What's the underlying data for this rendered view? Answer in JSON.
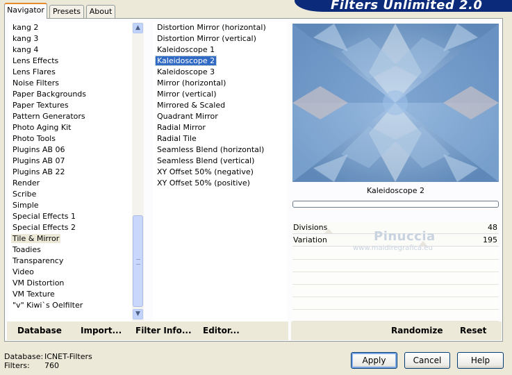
{
  "header": {
    "banner_text": "Filters Unlimited 2.0"
  },
  "tabs": [
    {
      "label": "Navigator",
      "active": true
    },
    {
      "label": "Presets",
      "active": false
    },
    {
      "label": "About",
      "active": false
    }
  ],
  "categories": {
    "items": [
      "kang 2",
      "kang 3",
      "kang 4",
      "Lens Effects",
      "Lens Flares",
      "Noise Filters",
      "Paper Backgrounds",
      "Paper Textures",
      "Pattern Generators",
      "Photo Aging Kit",
      "Photo Tools",
      "Plugins AB 06",
      "Plugins AB 07",
      "Plugins AB 22",
      "Render",
      "Scribe",
      "Simple",
      "Special Effects 1",
      "Special Effects 2",
      "Tile & Mirror",
      "Toadies",
      "Transparency",
      "Video",
      "VM Distortion",
      "VM Texture",
      "\"v\" Kiwi`s Oelfilter"
    ],
    "selected": "Tile & Mirror"
  },
  "filters": {
    "items": [
      "Distortion Mirror (horizontal)",
      "Distortion Mirror (vertical)",
      "Kaleidoscope 1",
      "Kaleidoscope 2",
      "Kaleidoscope 3",
      "Mirror (horizontal)",
      "Mirror (vertical)",
      "Mirrored & Scaled",
      "Quadrant Mirror",
      "Radial Mirror",
      "Radial Tile",
      "Seamless Blend (horizontal)",
      "Seamless Blend (vertical)",
      "XY Offset 50% (negative)",
      "XY Offset 50% (positive)"
    ],
    "selected": "Kaleidoscope 2"
  },
  "preview": {
    "filter_name": "Kaleidoscope 2",
    "progress": 0
  },
  "params": [
    {
      "name": "Divisions",
      "value": "48",
      "level": 0.19
    },
    {
      "name": "Variation",
      "value": "195",
      "level": 0.76
    }
  ],
  "watermark": {
    "line1": "Pinuccia",
    "line2": "www.maidiregrafica.eu"
  },
  "toolbar": {
    "database": "Database",
    "import": "Import...",
    "filter_info": "Filter Info...",
    "editor": "Editor...",
    "randomize": "Randomize",
    "reset": "Reset"
  },
  "status": {
    "database_label": "Database:",
    "database_value": "ICNET-Filters",
    "filters_label": "Filters:",
    "filters_value": "760"
  },
  "buttons": {
    "apply": "Apply",
    "cancel": "Cancel",
    "help": "Help"
  },
  "colors": {
    "selection": "#316AC5",
    "banner": "#0B2A7A",
    "preview_blue": "#7FA6CF"
  }
}
